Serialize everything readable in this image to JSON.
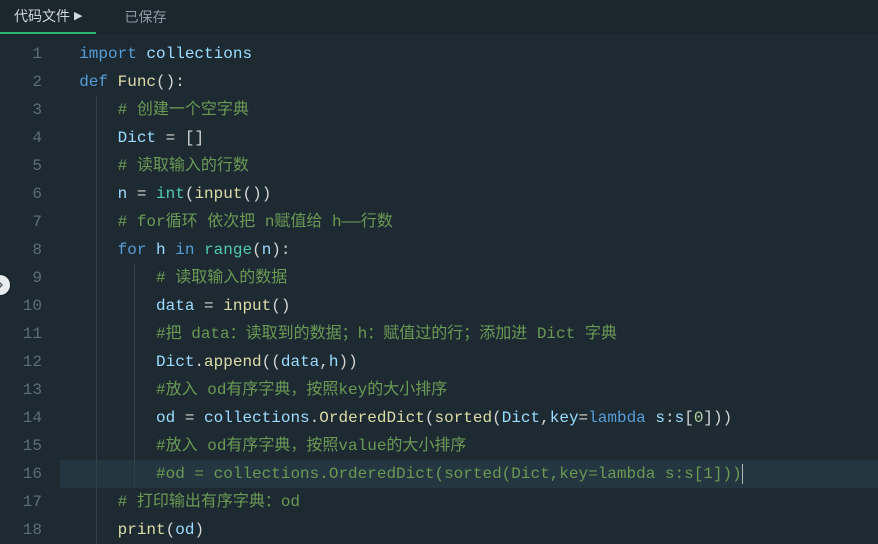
{
  "tabbar": {
    "tab_label": "代码文件",
    "tab_play_glyph": "▶",
    "saved_label": "已保存"
  },
  "lines": {
    "l1": {
      "n": "1"
    },
    "l2": {
      "n": "2"
    },
    "l3": {
      "n": "3",
      "c": "# 创建一个空字典"
    },
    "l4": {
      "n": "4"
    },
    "l5": {
      "n": "5",
      "c": "# 读取输入的行数"
    },
    "l6": {
      "n": "6"
    },
    "l7": {
      "n": "7",
      "c": "# for循环 依次把 n赋值给 h——行数"
    },
    "l8": {
      "n": "8"
    },
    "l9": {
      "n": "9",
      "c": "# 读取输入的数据"
    },
    "l10": {
      "n": "10"
    },
    "l11": {
      "n": "11",
      "c": "#把 data：读取到的数据；h：赋值过的行；添加进 Dict 字典"
    },
    "l12": {
      "n": "12"
    },
    "l13": {
      "n": "13",
      "c": "#放入 od有序字典，按照key的大小排序"
    },
    "l14": {
      "n": "14"
    },
    "l15": {
      "n": "15",
      "c": "#放入 od有序字典，按照value的大小排序"
    },
    "l16": {
      "n": "16",
      "c": "#od = collections.OrderedDict(sorted(Dict,key=lambda s:s[1]))"
    },
    "l17": {
      "n": "17",
      "c": "# 打印输出有序字典：od"
    },
    "l18": {
      "n": "18"
    }
  },
  "kw": {
    "import": "import",
    "def": "def",
    "for": "for",
    "in": "in",
    "lambda": "lambda"
  },
  "id": {
    "collections": "collections",
    "Func": "Func",
    "Dict": "Dict",
    "n": "n",
    "int": "int",
    "input": "input",
    "h": "h",
    "range": "range",
    "data": "data",
    "append": "append",
    "od": "od",
    "OrderedDict": "OrderedDict",
    "sorted": "sorted",
    "key": "key",
    "s": "s",
    "print": "print"
  },
  "num": {
    "zero": "0"
  },
  "punct": {
    "op_paren": "(",
    "cl_paren": ")",
    "colon": ":",
    "eq": " = ",
    "eq2": "=",
    "sqop": "[",
    "sqcl": "]",
    "comma": ",",
    "dot": "."
  }
}
